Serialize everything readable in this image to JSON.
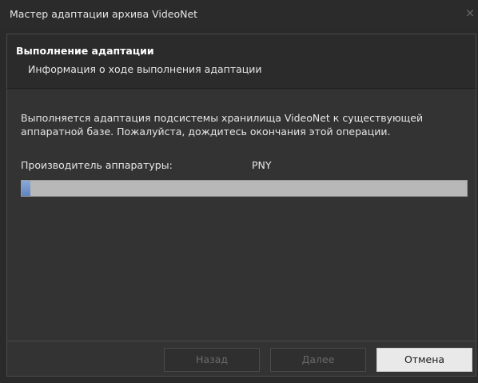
{
  "window": {
    "title": "Мастер адаптации архива VideoNet",
    "close_glyph": "×"
  },
  "header": {
    "title": "Выполнение адаптации",
    "subtitle": "Информация о ходе выполнения адаптации"
  },
  "body": {
    "description": "Выполняется адаптация подсистемы хранилища VideoNet к существующей аппаратной базе. Пожалуйста, дождитесь окончания этой операции.",
    "manufacturer_label": "Производитель аппаратуры:",
    "manufacturer_value": "PNY",
    "progress_fraction": 0.02
  },
  "buttons": {
    "back": "Назад",
    "next": "Далее",
    "cancel": "Отмена"
  },
  "colors": {
    "progress_fill": "#6f93c8",
    "progress_track": "#b8b8b8"
  }
}
